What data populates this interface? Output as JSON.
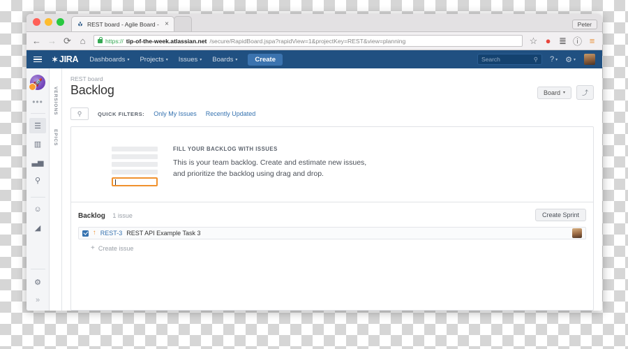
{
  "window": {
    "titlebar": {
      "tab_title": "REST board - Agile Board -",
      "tab_close": "×",
      "profile_button": "Peter"
    },
    "toolbar": {
      "back_icon": "←",
      "forward_icon": "→",
      "reload_icon": "⟳",
      "home_icon": "⌂",
      "url_scheme": "https://",
      "url_host": "tip-of-the-week.atlassian.net",
      "url_path": "/secure/RapidBoard.jspa?rapidView=1&projectKey=REST&view=planning",
      "star_icon": "☆",
      "opera_icon": "●",
      "layers_icon": "≣",
      "info_icon": "ⓘ",
      "menu_icon": "≡"
    }
  },
  "jira_nav": {
    "logo": "JIRA",
    "logo_mark": "✶",
    "items": [
      {
        "label": "Dashboards",
        "caret": "▾"
      },
      {
        "label": "Projects",
        "caret": "▾"
      },
      {
        "label": "Issues",
        "caret": "▾"
      },
      {
        "label": "Boards",
        "caret": "▾"
      }
    ],
    "create_label": "Create",
    "search_placeholder": "Search",
    "search_icon": "⚲",
    "help_icon": "?",
    "settings_icon": "⚙",
    "caret": "▾"
  },
  "rail": {
    "project_icon": "🚀",
    "more_icon": "•••",
    "items": [
      {
        "name": "backlog",
        "icon": "☰"
      },
      {
        "name": "board",
        "icon": "▥"
      },
      {
        "name": "reports",
        "icon": "▃▅"
      },
      {
        "name": "search",
        "icon": "⚲"
      },
      {
        "name": "add-people",
        "icon": "☺"
      },
      {
        "name": "announcement",
        "icon": "◢"
      }
    ],
    "settings_icon": "⚙",
    "expand_icon": "»",
    "vertical_labels": [
      "VERSIONS",
      "EPICS"
    ]
  },
  "page": {
    "breadcrumb": "REST board",
    "title": "Backlog",
    "board_button": "Board",
    "board_caret": "▾",
    "collapse_icon": "⤴"
  },
  "filters": {
    "search_icon": "⚲",
    "label": "QUICK FILTERS:",
    "links": [
      "Only My Issues",
      "Recently Updated"
    ]
  },
  "empty_state": {
    "heading": "FILL YOUR BACKLOG WITH ISSUES",
    "line1": "This is your team backlog. Create and estimate new issues,",
    "line2": "and prioritize the backlog using drag and drop.",
    "placeholder_bars": 4,
    "input_value": "",
    "accent_color": "#f0912d"
  },
  "backlog": {
    "title": "Backlog",
    "count": "1 issue",
    "create_sprint": "Create Sprint",
    "issues": [
      {
        "checked": true,
        "priority_icon": "↑",
        "key": "REST-3",
        "summary": "REST API Example Task 3"
      }
    ],
    "create_issue": "Create issue",
    "plus_icon": "+"
  }
}
